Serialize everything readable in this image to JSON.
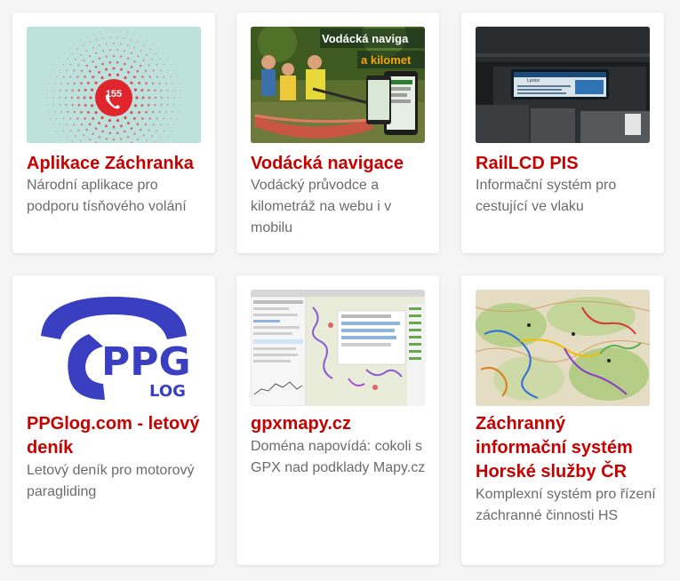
{
  "colors": {
    "title_red": "#c80000",
    "desc_gray": "#6b6b6b",
    "ppg_blue": "#3a3fc2"
  },
  "cards": [
    {
      "title": "Aplikace Záchranka",
      "description": "Národní aplikace pro podporu tísňového volání",
      "thumb_text": "155",
      "thumb_icon": "phone-icon"
    },
    {
      "title": "Vodácká navigace",
      "description": "Vodácký průvodce a kilometráž na webu i v mobilu",
      "thumb_line1": "Vodácká naviga",
      "thumb_line2": "a kilomet"
    },
    {
      "title": "RailLCD PIS",
      "description": "Informační systém pro cestující ve vlaku",
      "thumb_screen_text": "Lysice"
    },
    {
      "title": "PPGlog.com - letový deník",
      "description": "Letový deník pro motorový paragliding",
      "logo_main": "PPG",
      "logo_sub": "LOG"
    },
    {
      "title": "gpxmapy.cz",
      "description": "Doména napovídá: cokoli s GPX nad podklady Mapy.cz"
    },
    {
      "title": "Záchranný informační systém Horské služby ČR",
      "description": "Komplexní systém pro řízení záchranné činnosti HS"
    }
  ]
}
